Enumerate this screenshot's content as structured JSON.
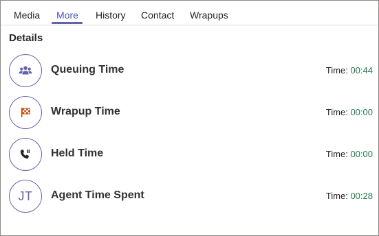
{
  "tabs": [
    {
      "label": "Media",
      "active": false
    },
    {
      "label": "More",
      "active": true
    },
    {
      "label": "History",
      "active": false
    },
    {
      "label": "Contact",
      "active": false
    },
    {
      "label": "Wrapups",
      "active": false
    }
  ],
  "details": {
    "title": "Details",
    "time_prefix": "Time:",
    "rows": [
      {
        "label": "Queuing Time",
        "icon": "people-icon",
        "time": "00:44"
      },
      {
        "label": "Wrapup Time",
        "icon": "checkered-flag-icon",
        "time": "00:00"
      },
      {
        "label": "Held Time",
        "icon": "phone-hold-icon",
        "time": "00:00"
      },
      {
        "label": "Agent Time Spent",
        "avatar_initials": "JT",
        "time": "00:28"
      }
    ]
  },
  "colors": {
    "accent": "#6264a7",
    "active_tab_text": "#4b53bc",
    "time_value": "#237b4b",
    "flag": "#c4501c"
  }
}
